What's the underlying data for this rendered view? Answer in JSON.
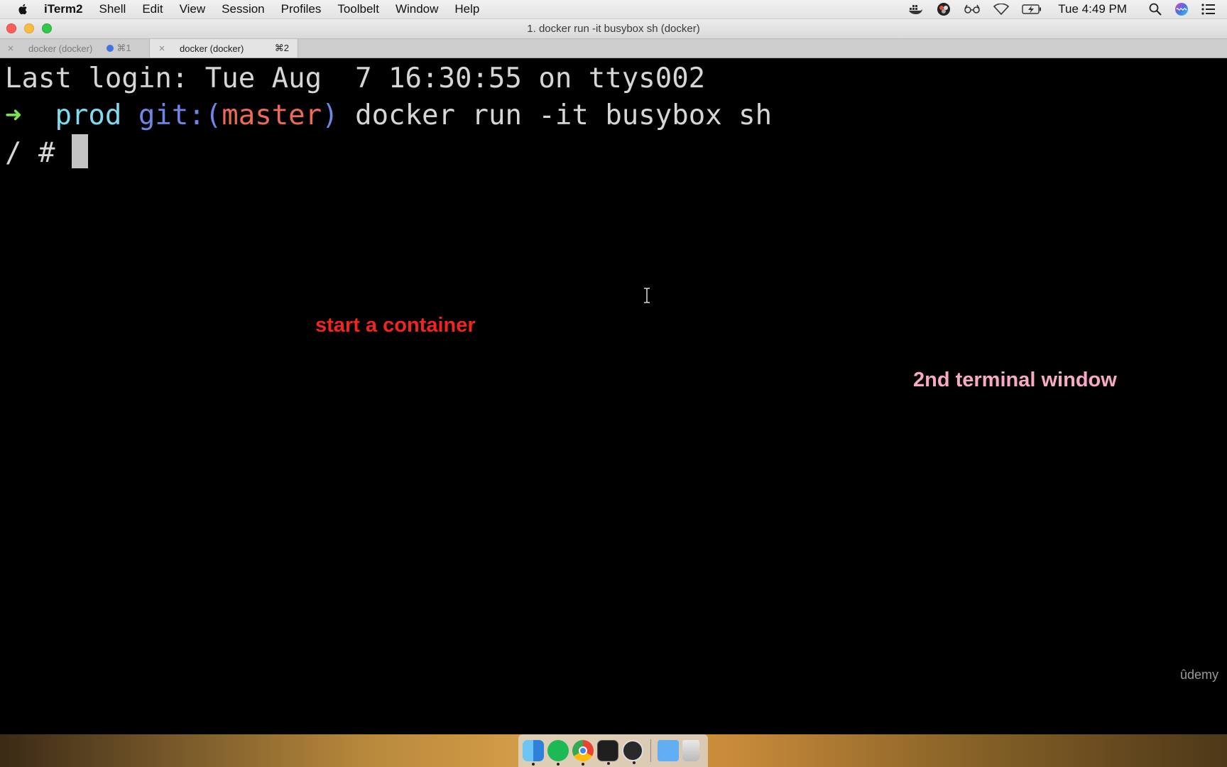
{
  "menubar": {
    "app_name": "iTerm2",
    "items": [
      "Shell",
      "Edit",
      "View",
      "Session",
      "Profiles",
      "Toolbelt",
      "Window",
      "Help"
    ],
    "clock": "Tue 4:49 PM"
  },
  "window": {
    "title": "1. docker run -it busybox sh (docker)"
  },
  "tabs": [
    {
      "label": "docker (docker)",
      "shortcut": "⌘1",
      "has_activity_dot": true,
      "active": false
    },
    {
      "label": "docker (docker)",
      "shortcut": "⌘2",
      "has_activity_dot": false,
      "active": true
    }
  ],
  "terminal": {
    "last_login": "Last login: Tue Aug  7 16:30:55 on ttys002",
    "prompt_arrow": "➜",
    "prompt_dir": "prod",
    "prompt_git_prefix": "git:(",
    "prompt_branch": "master",
    "prompt_git_suffix": ")",
    "command": "docker run -it busybox sh",
    "shell_prompt": "/ # "
  },
  "annotations": {
    "start_container": "start a container",
    "second_window": "2nd terminal window"
  },
  "watermark": "ûdemy",
  "colors": {
    "prompt_arrow": "#78e255",
    "prompt_dir": "#7fdcf0",
    "git_label": "#6d86e8",
    "branch": "#ec6a56",
    "annotation_red": "#f0251f",
    "annotation_pink": "#f7a9c6"
  },
  "dock": {
    "apps": [
      "finder-icon",
      "spotify-icon",
      "chrome-icon",
      "iterm-icon",
      "obs-icon",
      "folder-icon",
      "trash-icon"
    ]
  }
}
